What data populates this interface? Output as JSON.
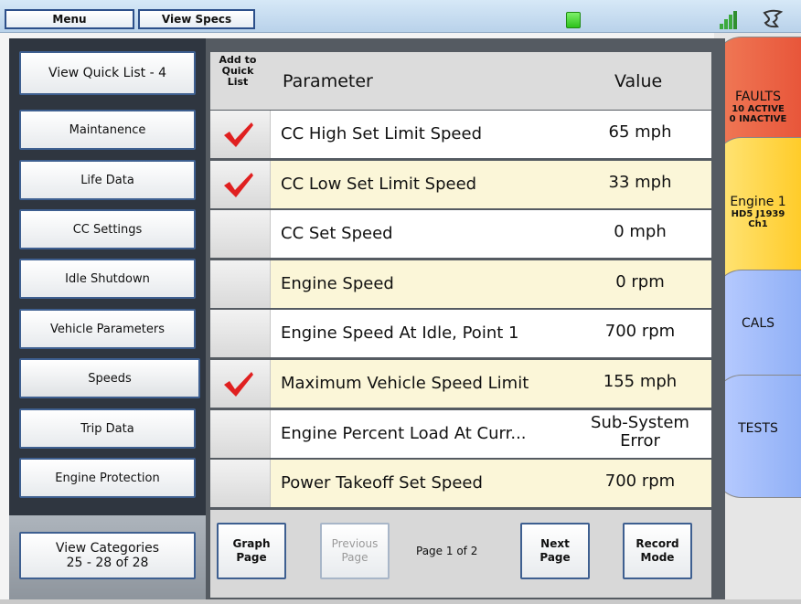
{
  "topbar": {
    "menu_label": "Menu",
    "view_specs_label": "View Specs",
    "status_led_color": "#3cd82a",
    "signal_icon": "signal-bars-icon",
    "brand_icon": "brand-logo-icon"
  },
  "sidebar": {
    "quick_list": "View Quick List - 4",
    "items": [
      {
        "label": "Maintanence"
      },
      {
        "label": "Life Data"
      },
      {
        "label": "CC Settings"
      },
      {
        "label": "Idle Shutdown"
      },
      {
        "label": "Vehicle Parameters"
      },
      {
        "label": "Speeds"
      },
      {
        "label": "Trip Data"
      },
      {
        "label": "Engine Protection"
      }
    ],
    "active_item": "Speeds",
    "categories_line1": "View Categories",
    "categories_line2": "25 - 28 of 28"
  },
  "table": {
    "col_quick_line1": "Add to",
    "col_quick_line2": "Quick",
    "col_quick_line3": "List",
    "col_param": "Parameter",
    "col_value": "Value",
    "rows": [
      {
        "param": "CC High Set Limit Speed",
        "value": "65 mph",
        "value2": "",
        "in_quick_list": true
      },
      {
        "param": "CC Low Set Limit Speed",
        "value": "33 mph",
        "value2": "",
        "in_quick_list": true
      },
      {
        "param": "CC Set Speed",
        "value": "0 mph",
        "value2": "",
        "in_quick_list": false
      },
      {
        "param": "Engine Speed",
        "value": "0 rpm",
        "value2": "",
        "in_quick_list": false
      },
      {
        "param": "Engine Speed At Idle, Point 1",
        "value": "700 rpm",
        "value2": "",
        "in_quick_list": false
      },
      {
        "param": "Maximum Vehicle Speed Limit",
        "value": "155 mph",
        "value2": "",
        "in_quick_list": true
      },
      {
        "param": "Engine Percent Load At Curr...",
        "value": "Sub-System",
        "value2": "Error",
        "in_quick_list": false
      },
      {
        "param": "Power Takeoff Set Speed",
        "value": "700 rpm",
        "value2": "",
        "in_quick_list": false
      }
    ],
    "row_colors": [
      "#ffffff",
      "#fbf6d8"
    ],
    "check_color": "#e02020"
  },
  "footer": {
    "graph_line1": "Graph",
    "graph_line2": "Page",
    "prev_line1": "Previous",
    "prev_line2": "Page",
    "page_info": "Page 1 of 2",
    "next_line1": "Next",
    "next_line2": "Page",
    "record_line1": "Record",
    "record_line2": "Mode"
  },
  "tabs": {
    "faults": {
      "title": "FAULTS",
      "line1": "10 ACTIVE",
      "line2": "0 INACTIVE"
    },
    "engine": {
      "title": "Engine 1",
      "line1": "HD5 J1939",
      "line2": "Ch1"
    },
    "cals": {
      "title": "CALS"
    },
    "tests": {
      "title": "TESTS"
    }
  }
}
